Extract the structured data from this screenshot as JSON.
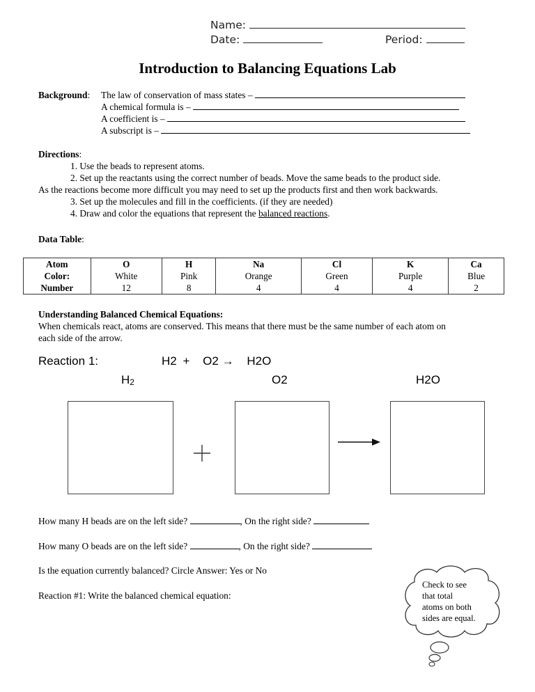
{
  "header": {
    "name_label": "Name:",
    "date_label": "Date:",
    "period_label": "Period:"
  },
  "title": "Introduction to Balancing Equations Lab",
  "background": {
    "label": "Background",
    "colon": ":",
    "items": [
      "The law of conservation of mass states –",
      "A chemical formula is –",
      "A coefficient is –",
      "A subscript is –"
    ]
  },
  "directions": {
    "label": "Directions",
    "colon": ":",
    "steps": [
      "1. Use the beads to represent atoms.",
      "2. Set up the reactants using the correct number of beads.  Move the same beads to the product side.",
      "As the reactions become more difficult you may need to set up the products first and then work backwards.",
      "3. Set up the molecules and fill in the coefficients. (if they are needed)",
      "4. Draw and color the equations that represent the "
    ],
    "step4_underlined": "balanced reactions",
    "step4_end": "."
  },
  "data_table": {
    "label": "Data Table",
    "colon": ":",
    "rows": [
      {
        "header": "Atom",
        "cells": [
          "O",
          "H",
          "Na",
          "Cl",
          "K",
          "Ca"
        ]
      },
      {
        "header": "Color:",
        "cells": [
          "White",
          "Pink",
          "Orange",
          "Green",
          "Purple",
          "Blue"
        ]
      },
      {
        "header": "Number",
        "cells": [
          "12",
          "8",
          "4",
          "4",
          "4",
          "2"
        ]
      }
    ]
  },
  "understanding": {
    "heading": "Understanding Balanced Chemical Equations:",
    "line1": "When chemicals react, atoms are conserved. This means that there must be the same number of each atom on",
    "line2": "each side of the arrow."
  },
  "reaction1": {
    "label": "Reaction 1:",
    "eq_h": "H",
    "eq_h_sub": "2",
    "plus": "+",
    "eq_o": "O",
    "eq_o_sub": "2",
    "arrow": "→",
    "eq_w": "H",
    "eq_w_sub": "2",
    "eq_w_end": "O",
    "box_labels": [
      {
        "base": "H",
        "sub": "2",
        "end": ""
      },
      {
        "base": "O",
        "sub": "2",
        "end": ""
      },
      {
        "base": "H",
        "sub": "2",
        "end": "O"
      }
    ]
  },
  "questions": {
    "q1a": "How many H beads are on the left side?",
    "q1b": ",  On the right side?",
    "q2a": "How many O beads are on the left side?",
    "q2b": ",  On the right side?",
    "q3": "Is the equation currently balanced?  Circle Answer:  Yes or  No",
    "q4": "Reaction #1:  Write the balanced chemical equation:"
  },
  "bubble": {
    "lines": [
      "Check to see",
      "that total",
      "atoms on both",
      "sides are equal."
    ]
  }
}
